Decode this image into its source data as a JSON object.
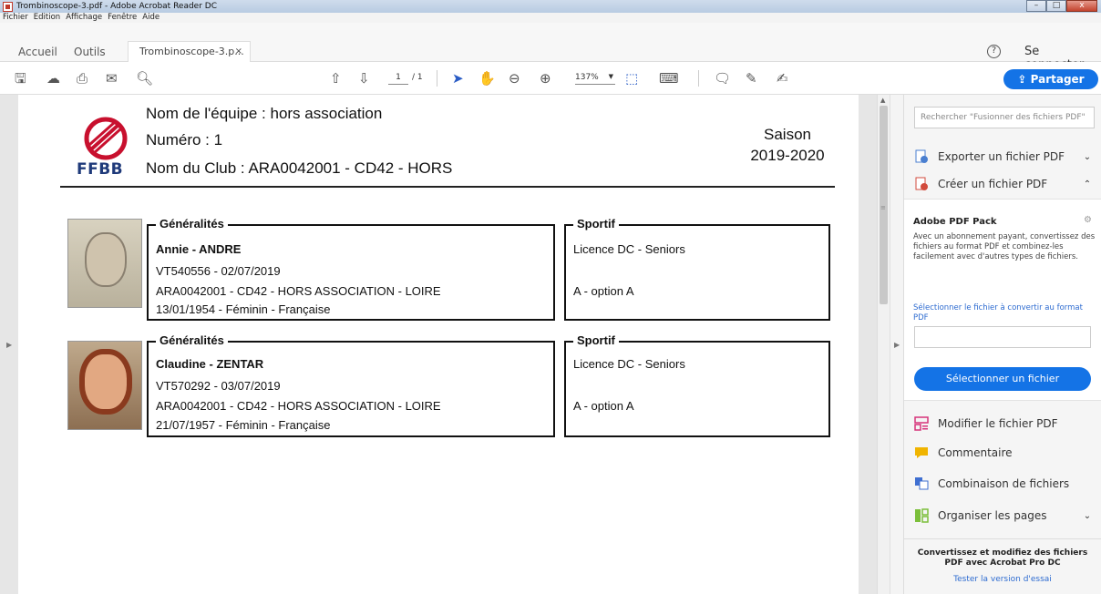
{
  "window": {
    "title": "Trombinoscope-3.pdf - Adobe Acrobat Reader DC"
  },
  "menu": [
    "Fichier",
    "Edition",
    "Affichage",
    "Fenêtre",
    "Aide"
  ],
  "tabs": {
    "home": "Accueil",
    "tools": "Outils",
    "doc": "Trombinoscope-3.p...",
    "close": "×"
  },
  "header_right": {
    "help": "?",
    "signin": "Se connecter"
  },
  "toolbar": {
    "page_current": "1",
    "page_total": "/ 1",
    "zoom": "137%",
    "share": "Partager"
  },
  "document": {
    "logo_text": "FFBB",
    "team": "Nom de l'équipe : hors association",
    "number": "Numéro : 1",
    "club": "Nom du Club : ARA0042001 - CD42 - HORS",
    "season_label": "Saison",
    "season_value": "2019-2020",
    "players": [
      {
        "general_title": "Généralités",
        "name": "Annie - ANDRE",
        "license": "VT540556 - 02/07/2019",
        "club": "ARA0042001 - CD42 - HORS ASSOCIATION - LOIRE",
        "birth": "13/01/1954 -  Féminin - Française",
        "sport_title": "Sportif",
        "licence_type": "Licence DC - Seniors",
        "option": "A - option A"
      },
      {
        "general_title": "Généralités",
        "name": "Claudine - ZENTAR",
        "license": "VT570292 - 03/07/2019",
        "club": "ARA0042001 - CD42 - HORS ASSOCIATION - LOIRE",
        "birth": "21/07/1957 -  Féminin - Française",
        "sport_title": "Sportif",
        "licence_type": "Licence DC - Seniors",
        "option": "A - option A"
      }
    ]
  },
  "right_pane": {
    "search_placeholder": "Rechercher \"Fusionner des fichiers PDF\"",
    "export": "Exporter un fichier PDF",
    "create": "Créer un fichier PDF",
    "pack_title": "Adobe PDF Pack",
    "pack_desc": "Avec un abonnement payant, convertissez des fichiers au format PDF et combinez-les facilement avec d'autres types de fichiers.",
    "pack_link": "Sélectionner le fichier à convertir au format PDF",
    "pack_button": "Sélectionner un fichier",
    "tools": [
      "Modifier le fichier PDF",
      "Commentaire",
      "Combinaison de fichiers",
      "Organiser les pages"
    ],
    "promo_title": "Convertissez et modifiez des fichiers PDF avec Acrobat Pro DC",
    "promo_link": "Tester la version d'essai"
  },
  "colors": {
    "accent": "#1473e6",
    "logo_red": "#c8102e",
    "logo_navy": "#1f3a7a"
  }
}
